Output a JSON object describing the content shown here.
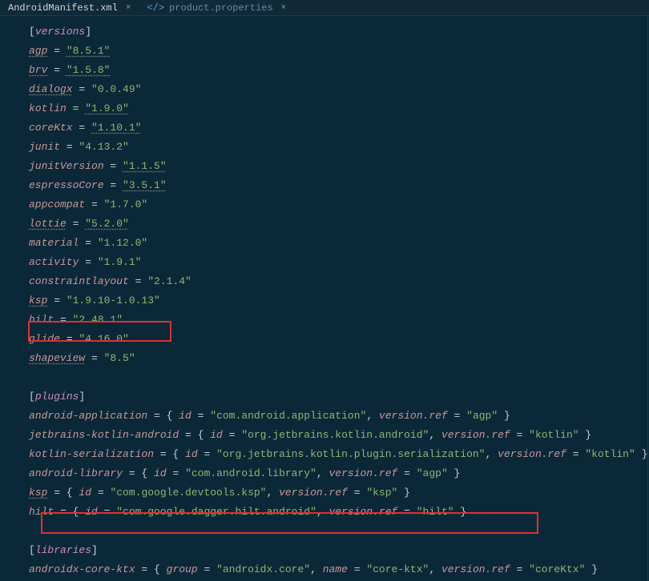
{
  "tabs": [
    {
      "label": "AndroidManifest.xml",
      "active": true,
      "icon": ""
    },
    {
      "label": "product.properties",
      "active": false,
      "icon": "</>"
    }
  ],
  "sections": {
    "versions": "[versions]",
    "plugins": "[plugins]",
    "libraries": "[libraries]"
  },
  "versions": {
    "agp": {
      "k": "agp",
      "v": "\"8.5.1\""
    },
    "brv": {
      "k": "brv",
      "v": "\"1.5.8\""
    },
    "dialogx": {
      "k": "dialogx",
      "v": "\"0.0.49\""
    },
    "kotlin": {
      "k": "kotlin",
      "v": "\"1.9.0\""
    },
    "coreKtx": {
      "k": "coreKtx",
      "v": "\"1.10.1\""
    },
    "junit": {
      "k": "junit",
      "v": "\"4.13.2\""
    },
    "junitVersion": {
      "k": "junitVersion",
      "v": "\"1.1.5\""
    },
    "espressoCore": {
      "k": "espressoCore",
      "v": "\"3.5.1\""
    },
    "appcompat": {
      "k": "appcompat",
      "v": "\"1.7.0\""
    },
    "lottie": {
      "k": "lottie",
      "v": "\"5.2.0\""
    },
    "material": {
      "k": "material",
      "v": "\"1.12.0\""
    },
    "activity": {
      "k": "activity",
      "v": "\"1.9.1\""
    },
    "constraintlayout": {
      "k": "constraintlayout",
      "v": "\"2.1.4\""
    },
    "ksp": {
      "k": "ksp",
      "v": "\"1.9.10-1.0.13\""
    },
    "hilt": {
      "k": "hilt",
      "v": "\"2.48.1\""
    },
    "glide": {
      "k": "glide",
      "v": "\"4.16.0\""
    },
    "shapeview": {
      "k": "shapeview",
      "v": "\"8.5\""
    }
  },
  "eq": " = ",
  "plugins": {
    "androidApp": {
      "k": "android-application",
      "open": " = { ",
      "idk": "id",
      "idv": "\"com.android.application\"",
      "sep": ", ",
      "refk": "version.ref",
      "refv": "\"agp\"",
      "close": " }"
    },
    "jbKotlin": {
      "k": "jetbrains-kotlin-android",
      "open": " = { ",
      "idk": "id",
      "idv": "\"org.jetbrains.kotlin.android\"",
      "sep": ", ",
      "refk": "version.ref",
      "refv": "\"kotlin\"",
      "close": " }"
    },
    "kotlinSer": {
      "k": "kotlin-serialization",
      "open": " = { ",
      "idk": "id",
      "idv": "\"org.jetbrains.kotlin.plugin.serialization\"",
      "sep": ", ",
      "refk": "version.ref",
      "refv": "\"kotlin\"",
      "close": " }"
    },
    "androidLib": {
      "k": "android-library",
      "open": " = { ",
      "idk": "id",
      "idv": "\"com.android.library\"",
      "sep": ", ",
      "refk": "version.ref",
      "refv": "\"agp\"",
      "close": " }"
    },
    "ksp": {
      "k": "ksp",
      "open": " = { ",
      "idk": "id",
      "idv": "\"com.google.devtools.ksp\"",
      "sep": ", ",
      "refk": "version.ref",
      "refv": "\"ksp\"",
      "close": " }"
    },
    "hilt": {
      "k": "hilt",
      "open": " = { ",
      "idk": "id",
      "idv": "\"com.google.dagger.hilt.android\"",
      "sep": ", ",
      "refk": "version.ref",
      "refv": "\"hilt\"",
      "close": " }"
    }
  },
  "libraries": {
    "coreKtx": {
      "k": "androidx-core-ktx",
      "open": " = { ",
      "grpk": "group",
      "grpv": "\"androidx.core\"",
      "sep": ", ",
      "namek": "name",
      "namev": "\"core-ktx\"",
      "refk": "version.ref",
      "refv": "\"coreKtx\"",
      "close": " }"
    }
  }
}
